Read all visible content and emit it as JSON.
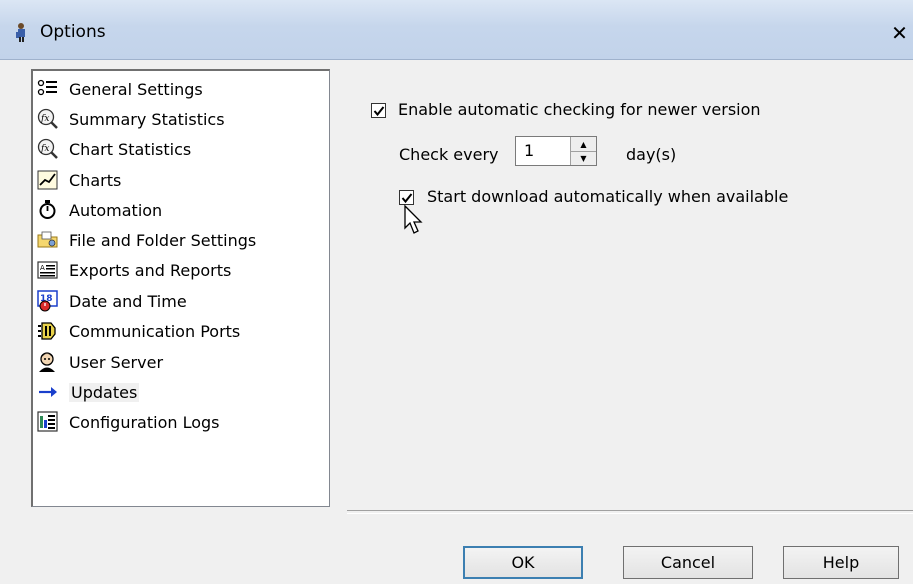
{
  "window": {
    "title": "Options",
    "close_label": "✕"
  },
  "nav": {
    "items": [
      {
        "label": "General Settings",
        "icon": "settings-list-icon"
      },
      {
        "label": "Summary Statistics",
        "icon": "fx-statistics-icon"
      },
      {
        "label": "Chart Statistics",
        "icon": "fx-statistics-icon"
      },
      {
        "label": "Charts",
        "icon": "line-chart-icon"
      },
      {
        "label": "Automation",
        "icon": "stopwatch-icon"
      },
      {
        "label": "File and Folder Settings",
        "icon": "folder-icon"
      },
      {
        "label": "Exports and Reports",
        "icon": "report-icon"
      },
      {
        "label": "Date and Time",
        "icon": "calendar-clock-icon"
      },
      {
        "label": "Communication Ports",
        "icon": "port-icon"
      },
      {
        "label": "User Server",
        "icon": "user-server-icon"
      },
      {
        "label": "Updates",
        "icon": "arrow-right-icon"
      },
      {
        "label": "Configuration Logs",
        "icon": "log-icon"
      }
    ],
    "selected": "Updates"
  },
  "updates": {
    "enable_auto_check": {
      "label": "Enable automatic checking for newer version",
      "checked": true
    },
    "check_every_label": "Check every",
    "check_every_value": "1",
    "check_every_unit": "day(s)",
    "auto_download": {
      "label": "Start download automatically when available",
      "checked": true
    }
  },
  "buttons": {
    "ok": "OK",
    "cancel": "Cancel",
    "help": "Help"
  },
  "colors": {
    "titlebar": "#c6d6ec",
    "arrow_blue": "#1a3fcc",
    "ok_border": "#3c7fb1"
  }
}
